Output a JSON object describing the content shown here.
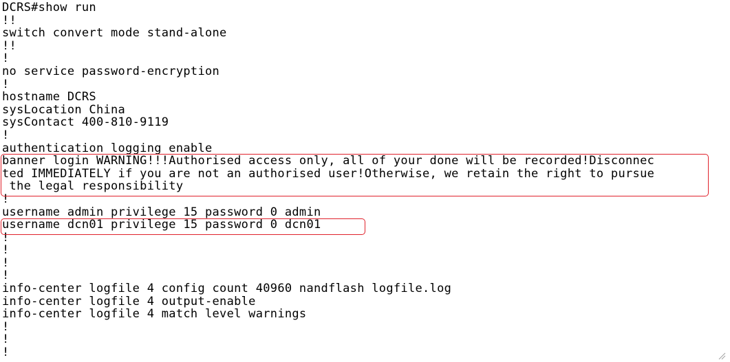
{
  "terminal": {
    "lines": [
      "DCRS#show run",
      "!!",
      "switch convert mode stand-alone",
      "!!",
      "!",
      "no service password-encryption",
      "!",
      "hostname DCRS",
      "sysLocation China",
      "sysContact 400-810-9119",
      "!",
      "authentication logging enable",
      "banner login WARNING!!!Authorised access only, all of your done will be recorded!Disconnec",
      "ted IMMEDIATELY if you are not an authorised user!Otherwise, we retain the right to pursue",
      " the legal responsibility",
      "!",
      "username admin privilege 15 password 0 admin",
      "username dcn01 privilege 15 password 0 dcn01",
      "!",
      "!",
      "!",
      "!",
      "info-center logfile 4 config count 40960 nandflash logfile.log",
      "info-center logfile 4 output-enable",
      "info-center logfile 4 match level warnings",
      "!",
      "!",
      "!"
    ]
  },
  "highlights": {
    "color": "#e0202a",
    "banner_block": "banner login",
    "user_line": "username dcn01"
  },
  "colors": {
    "background": "#ffffff",
    "text": "#000000"
  },
  "icons": {
    "resize_grip": "resize-grip-icon"
  }
}
